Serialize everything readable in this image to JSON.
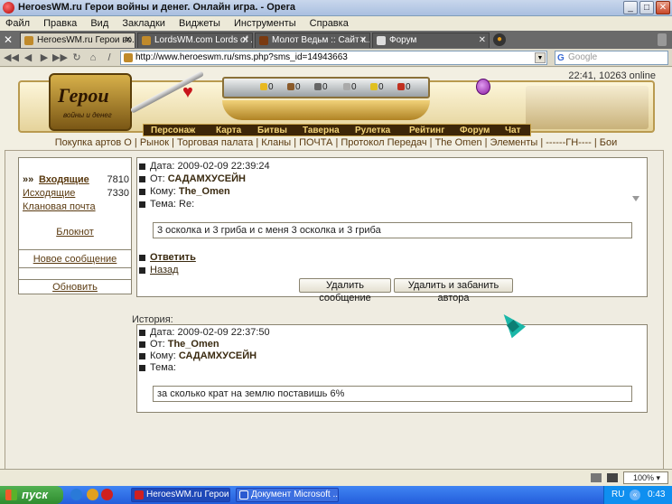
{
  "window": {
    "title": "HeroesWM.ru Герои войны и денег. Онлайн игра. - Opera"
  },
  "menu": [
    "Файл",
    "Правка",
    "Вид",
    "Закладки",
    "Виджеты",
    "Инструменты",
    "Справка"
  ],
  "tabs": [
    {
      "label": "HeroesWM.ru Герои во...",
      "active": true
    },
    {
      "label": "LordsWM.com Lords of ...",
      "active": false
    },
    {
      "label": "Молот Ведьм :: Сайт к...",
      "active": false
    },
    {
      "label": "Форум",
      "active": false
    }
  ],
  "address": {
    "url": "http://www.heroeswm.ru/sms.php?sms_id=14943663",
    "search_placeholder": "Google"
  },
  "online_status": "22:41, 10263 online",
  "banner": {
    "logo_text": "Герои",
    "logo_sub": "войны и денег",
    "resources": [
      "0",
      "0",
      "0",
      "0",
      "0",
      "0"
    ]
  },
  "game_nav": [
    "Персонаж",
    "Карта",
    "Битвы",
    "Таверна",
    "Рулетка",
    "Рейтинг",
    "Форум",
    "Чат"
  ],
  "top_links": "Покупка артов О | Рынок | Торговая палата | Кланы | ПОЧТА | Протокол Передач | The Omen | Элементы | ------ГН---- | Бои",
  "sidebar": {
    "inbox_marker": "»»",
    "inbox_label": "Входящие",
    "inbox_count": "7810",
    "outbox_label": "Исходящие",
    "outbox_count": "7330",
    "clan_mail": "Клановая почта",
    "notepad": "Блокнот",
    "new_message": "Новое сообщение",
    "refresh": "Обновить"
  },
  "message": {
    "date_label": "Дата:",
    "date": "2009-02-09 22:39:24",
    "from_label": "От:",
    "from": "САДАМХУСЕЙН",
    "to_label": "Кому:",
    "to": "The_Omen",
    "subject_label": "Тема:",
    "subject": "Re:",
    "body": "3 осколка и 3 гриба и с меня 3 осколка и 3 гриба",
    "reply": "Ответить",
    "back": "Назад",
    "delete_btn": "Удалить сообщение",
    "delete_ban_btn": "Удалить и забанить автора"
  },
  "history": {
    "label": "История:",
    "date_label": "Дата:",
    "date": "2009-02-09 22:37:50",
    "from_label": "От:",
    "from": "The_Omen",
    "to_label": "Кому:",
    "to": "САДАМХУСЕЙН",
    "subject_label": "Тема:",
    "subject": "",
    "body": "за сколько крат на землю поставишь 6%"
  },
  "statusbar": {
    "zoom": "100%"
  },
  "taskbar": {
    "start": "пуск",
    "buttons": [
      {
        "label": "HeroesWM.ru Герои ...",
        "active": true
      },
      {
        "label": "Документ Microsoft ...",
        "active": false
      }
    ],
    "lang": "RU",
    "clock": "0:43"
  },
  "colors": {
    "accent_gold": "#c7a24a",
    "nav_bg": "#3d2608",
    "link_brown": "#5a3a10",
    "taskbar_blue": "#245edb",
    "start_green": "#2f8c2f"
  }
}
